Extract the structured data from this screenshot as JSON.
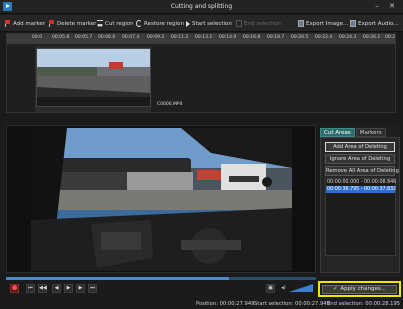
{
  "window": {
    "title": "Cutting and splitting"
  },
  "toolbar": {
    "add_marker": "Add marker",
    "delete_marker": "Delete marker",
    "cut_region": "Cut region",
    "restore_region": "Restore region",
    "start_selection": "Start selection",
    "end_selection": "End selection",
    "export_image": "Export Image...",
    "export_audio": "Export Audio..."
  },
  "timeline": {
    "ticks": [
      "00:0",
      "00:05.8",
      "00:05.7",
      "00:06.6",
      "00:07.4",
      "00:09.2",
      "00:11.2",
      "00:13.1",
      "00:14.9",
      "00:16.8",
      "00:18.7",
      "00:20.5",
      "00:22.4",
      "00:24.3",
      "00:26.1",
      "00:2"
    ],
    "clip_name": "C0006.MP4"
  },
  "side_panel": {
    "tabs": [
      "Cut Areas",
      "Markers"
    ],
    "add_area": "Add Area of Deleting",
    "ignore_area": "Ignore Area of Deleting",
    "remove_all": "Remove All Area of Deleting",
    "cut_areas": [
      "00:00:00.000 - 00:00:08.846",
      "00:00:36.795 - 00:00:37.832"
    ]
  },
  "player": {
    "progress": 0.72
  },
  "controls": {
    "record_icon": "record-icon",
    "skip_start": "⏮",
    "prev_frame": "◀◀",
    "step_back": "◀",
    "play": "▶",
    "step_fwd": "▶",
    "skip_end": "⏭"
  },
  "apply": {
    "label": "Apply changes..."
  },
  "status": {
    "position": "Position: 00:00:27.949",
    "start_selection": "Start selection: 00:00:27.949",
    "end_selection": "End selection: 00:00:28.195"
  },
  "colors": {
    "accent": "#2d6e6a",
    "selection": "#2c6fd0",
    "highlight": "#f2e600"
  }
}
